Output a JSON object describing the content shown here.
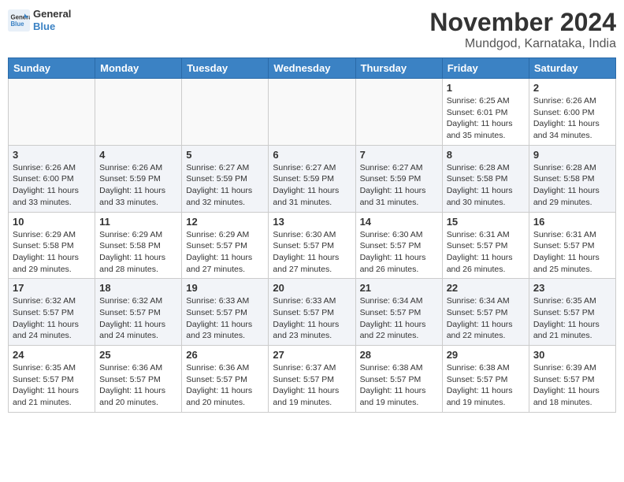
{
  "logo": {
    "line1": "General",
    "line2": "Blue"
  },
  "title": "November 2024",
  "location": "Mundgod, Karnataka, India",
  "weekdays": [
    "Sunday",
    "Monday",
    "Tuesday",
    "Wednesday",
    "Thursday",
    "Friday",
    "Saturday"
  ],
  "weeks": [
    [
      {
        "day": "",
        "detail": ""
      },
      {
        "day": "",
        "detail": ""
      },
      {
        "day": "",
        "detail": ""
      },
      {
        "day": "",
        "detail": ""
      },
      {
        "day": "",
        "detail": ""
      },
      {
        "day": "1",
        "detail": "Sunrise: 6:25 AM\nSunset: 6:01 PM\nDaylight: 11 hours\nand 35 minutes."
      },
      {
        "day": "2",
        "detail": "Sunrise: 6:26 AM\nSunset: 6:00 PM\nDaylight: 11 hours\nand 34 minutes."
      }
    ],
    [
      {
        "day": "3",
        "detail": "Sunrise: 6:26 AM\nSunset: 6:00 PM\nDaylight: 11 hours\nand 33 minutes."
      },
      {
        "day": "4",
        "detail": "Sunrise: 6:26 AM\nSunset: 5:59 PM\nDaylight: 11 hours\nand 33 minutes."
      },
      {
        "day": "5",
        "detail": "Sunrise: 6:27 AM\nSunset: 5:59 PM\nDaylight: 11 hours\nand 32 minutes."
      },
      {
        "day": "6",
        "detail": "Sunrise: 6:27 AM\nSunset: 5:59 PM\nDaylight: 11 hours\nand 31 minutes."
      },
      {
        "day": "7",
        "detail": "Sunrise: 6:27 AM\nSunset: 5:59 PM\nDaylight: 11 hours\nand 31 minutes."
      },
      {
        "day": "8",
        "detail": "Sunrise: 6:28 AM\nSunset: 5:58 PM\nDaylight: 11 hours\nand 30 minutes."
      },
      {
        "day": "9",
        "detail": "Sunrise: 6:28 AM\nSunset: 5:58 PM\nDaylight: 11 hours\nand 29 minutes."
      }
    ],
    [
      {
        "day": "10",
        "detail": "Sunrise: 6:29 AM\nSunset: 5:58 PM\nDaylight: 11 hours\nand 29 minutes."
      },
      {
        "day": "11",
        "detail": "Sunrise: 6:29 AM\nSunset: 5:58 PM\nDaylight: 11 hours\nand 28 minutes."
      },
      {
        "day": "12",
        "detail": "Sunrise: 6:29 AM\nSunset: 5:57 PM\nDaylight: 11 hours\nand 27 minutes."
      },
      {
        "day": "13",
        "detail": "Sunrise: 6:30 AM\nSunset: 5:57 PM\nDaylight: 11 hours\nand 27 minutes."
      },
      {
        "day": "14",
        "detail": "Sunrise: 6:30 AM\nSunset: 5:57 PM\nDaylight: 11 hours\nand 26 minutes."
      },
      {
        "day": "15",
        "detail": "Sunrise: 6:31 AM\nSunset: 5:57 PM\nDaylight: 11 hours\nand 26 minutes."
      },
      {
        "day": "16",
        "detail": "Sunrise: 6:31 AM\nSunset: 5:57 PM\nDaylight: 11 hours\nand 25 minutes."
      }
    ],
    [
      {
        "day": "17",
        "detail": "Sunrise: 6:32 AM\nSunset: 5:57 PM\nDaylight: 11 hours\nand 24 minutes."
      },
      {
        "day": "18",
        "detail": "Sunrise: 6:32 AM\nSunset: 5:57 PM\nDaylight: 11 hours\nand 24 minutes."
      },
      {
        "day": "19",
        "detail": "Sunrise: 6:33 AM\nSunset: 5:57 PM\nDaylight: 11 hours\nand 23 minutes."
      },
      {
        "day": "20",
        "detail": "Sunrise: 6:33 AM\nSunset: 5:57 PM\nDaylight: 11 hours\nand 23 minutes."
      },
      {
        "day": "21",
        "detail": "Sunrise: 6:34 AM\nSunset: 5:57 PM\nDaylight: 11 hours\nand 22 minutes."
      },
      {
        "day": "22",
        "detail": "Sunrise: 6:34 AM\nSunset: 5:57 PM\nDaylight: 11 hours\nand 22 minutes."
      },
      {
        "day": "23",
        "detail": "Sunrise: 6:35 AM\nSunset: 5:57 PM\nDaylight: 11 hours\nand 21 minutes."
      }
    ],
    [
      {
        "day": "24",
        "detail": "Sunrise: 6:35 AM\nSunset: 5:57 PM\nDaylight: 11 hours\nand 21 minutes."
      },
      {
        "day": "25",
        "detail": "Sunrise: 6:36 AM\nSunset: 5:57 PM\nDaylight: 11 hours\nand 20 minutes."
      },
      {
        "day": "26",
        "detail": "Sunrise: 6:36 AM\nSunset: 5:57 PM\nDaylight: 11 hours\nand 20 minutes."
      },
      {
        "day": "27",
        "detail": "Sunrise: 6:37 AM\nSunset: 5:57 PM\nDaylight: 11 hours\nand 19 minutes."
      },
      {
        "day": "28",
        "detail": "Sunrise: 6:38 AM\nSunset: 5:57 PM\nDaylight: 11 hours\nand 19 minutes."
      },
      {
        "day": "29",
        "detail": "Sunrise: 6:38 AM\nSunset: 5:57 PM\nDaylight: 11 hours\nand 19 minutes."
      },
      {
        "day": "30",
        "detail": "Sunrise: 6:39 AM\nSunset: 5:57 PM\nDaylight: 11 hours\nand 18 minutes."
      }
    ]
  ]
}
